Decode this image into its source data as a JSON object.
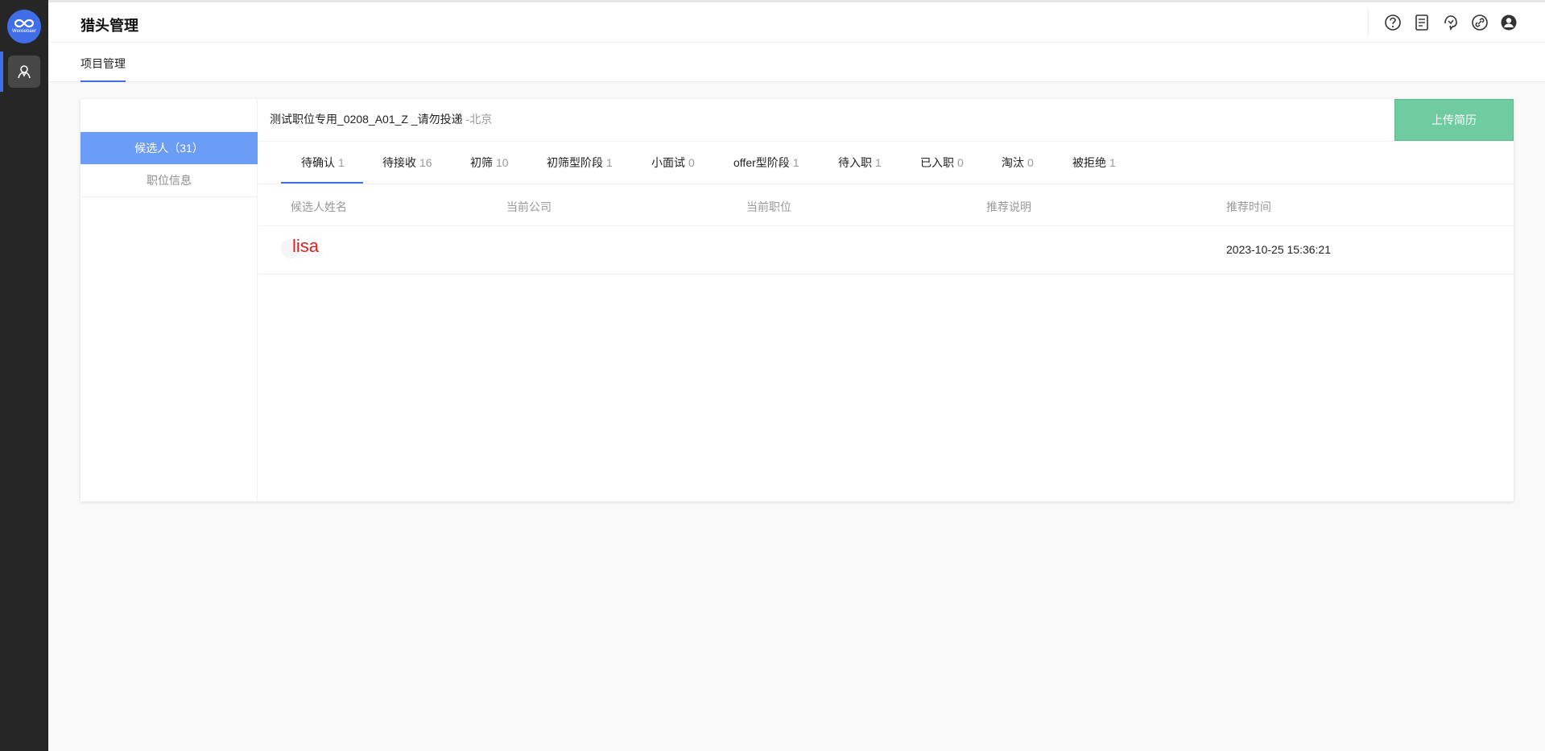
{
  "header": {
    "title": "猎头管理",
    "nav_tab": "项目管理",
    "icons": [
      "help-icon",
      "document-icon",
      "support-icon",
      "link-icon",
      "user-icon"
    ]
  },
  "rail": {
    "logo_text": "Weixiebaer",
    "items": [
      "headhunter-icon"
    ],
    "accent": "#3f6ee8"
  },
  "sidebar": {
    "active_label": "候选人（31）",
    "item_label": "职位信息"
  },
  "job": {
    "title": "测试职位专用_0208_A01_Z _请勿投递",
    "city": "-北京",
    "upload_label": "上传简历"
  },
  "tabs": [
    {
      "label": "待确认",
      "count": "1"
    },
    {
      "label": "待接收",
      "count": "16"
    },
    {
      "label": "初筛",
      "count": "10"
    },
    {
      "label": "初筛型阶段",
      "count": "1"
    },
    {
      "label": "小面试",
      "count": "0"
    },
    {
      "label": "offer型阶段",
      "count": "1"
    },
    {
      "label": "待入职",
      "count": "1"
    },
    {
      "label": "已入职",
      "count": "0"
    },
    {
      "label": "淘汰",
      "count": "0"
    },
    {
      "label": "被拒绝",
      "count": "1"
    }
  ],
  "table": {
    "columns": [
      "候选人姓名",
      "当前公司",
      "当前职位",
      "推荐说明",
      "推荐时间"
    ],
    "rows": [
      {
        "name": "lisa",
        "company": "",
        "position": "",
        "note": "",
        "time": "2023-10-25 15:36:21"
      }
    ]
  },
  "colors": {
    "accent": "#3f6ee8",
    "sidebar_active": "#6b9cf6",
    "upload_button": "#6fcba0",
    "candidate_name": "#e02020"
  }
}
